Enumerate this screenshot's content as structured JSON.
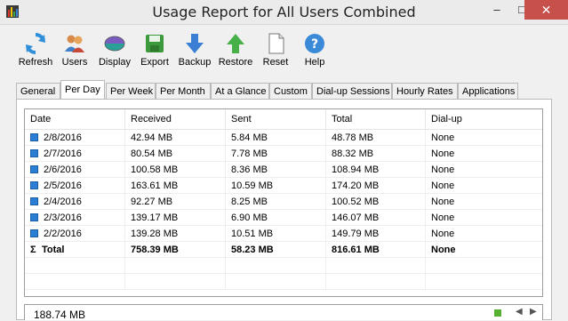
{
  "window": {
    "title": "Usage Report for All Users Combined",
    "minimize": "–",
    "maximize": "□",
    "close": "✕"
  },
  "toolbar": [
    {
      "label": "Refresh",
      "icon": "refresh-icon"
    },
    {
      "label": "Users",
      "icon": "users-icon"
    },
    {
      "label": "Display",
      "icon": "display-icon"
    },
    {
      "label": "Export",
      "icon": "export-icon"
    },
    {
      "label": "Backup",
      "icon": "backup-icon"
    },
    {
      "label": "Restore",
      "icon": "restore-icon"
    },
    {
      "label": "Reset",
      "icon": "reset-icon"
    },
    {
      "label": "Help",
      "icon": "help-icon"
    }
  ],
  "tabs": [
    {
      "label": "General"
    },
    {
      "label": "Per Day",
      "active": true
    },
    {
      "label": "Per Week"
    },
    {
      "label": "Per Month"
    },
    {
      "label": "At a Glance"
    },
    {
      "label": "Custom"
    },
    {
      "label": "Dial-up Sessions"
    },
    {
      "label": "Hourly Rates"
    },
    {
      "label": "Applications"
    }
  ],
  "table": {
    "columns": [
      "Date",
      "Received",
      "Sent",
      "Total",
      "Dial-up"
    ],
    "rows": [
      [
        "2/8/2016",
        "42.94 MB",
        "5.84 MB",
        "48.78 MB",
        "None"
      ],
      [
        "2/7/2016",
        "80.54 MB",
        "7.78 MB",
        "88.32 MB",
        "None"
      ],
      [
        "2/6/2016",
        "100.58 MB",
        "8.36 MB",
        "108.94 MB",
        "None"
      ],
      [
        "2/5/2016",
        "163.61 MB",
        "10.59 MB",
        "174.20 MB",
        "None"
      ],
      [
        "2/4/2016",
        "92.27 MB",
        "8.25 MB",
        "100.52 MB",
        "None"
      ],
      [
        "2/3/2016",
        "139.17 MB",
        "6.90 MB",
        "146.07 MB",
        "None"
      ],
      [
        "2/2/2016",
        "139.28 MB",
        "10.51 MB",
        "149.79 MB",
        "None"
      ]
    ],
    "total": [
      "Total",
      "758.39 MB",
      "58.23 MB",
      "816.61 MB",
      "None"
    ]
  },
  "graph": {
    "max_label": "188.74 MB"
  },
  "colors": {
    "close_button": "#c7504b",
    "row_marker": "#2a7fd4"
  }
}
